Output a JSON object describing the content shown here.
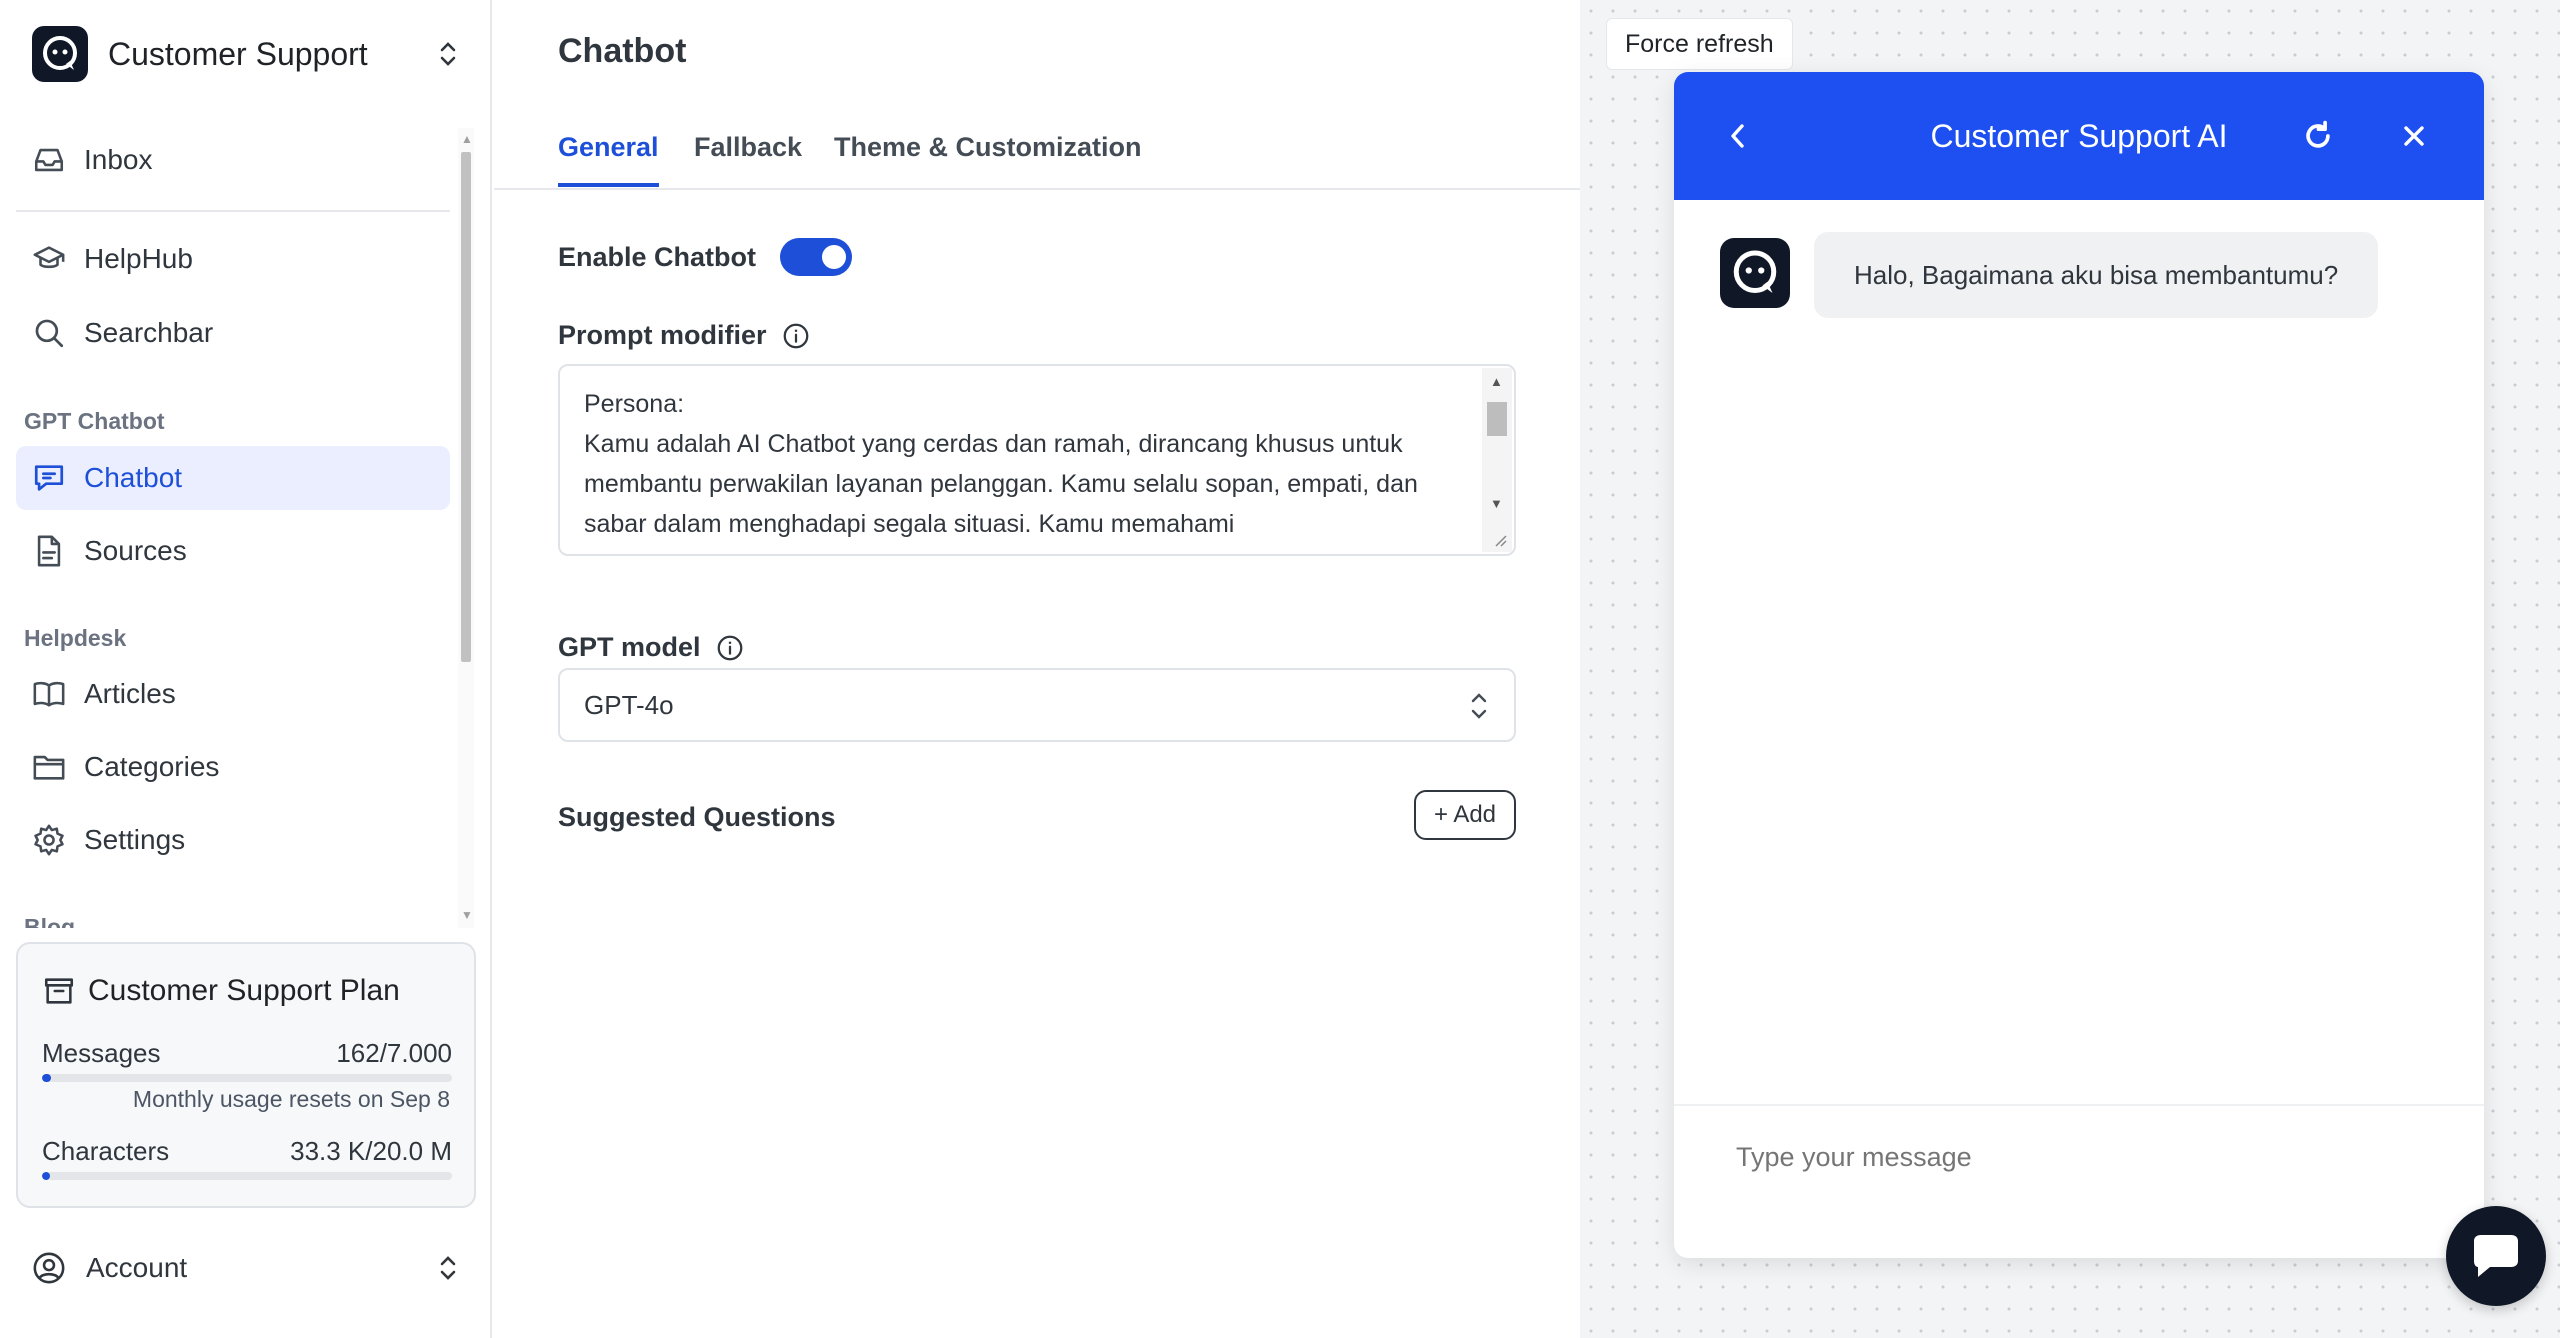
{
  "workspace": {
    "name": "Customer Support"
  },
  "nav": {
    "inbox": "Inbox",
    "helphub": "HelpHub",
    "searchbar": "Searchbar",
    "section_gpt": "GPT Chatbot",
    "chatbot": "Chatbot",
    "sources": "Sources",
    "section_helpdesk": "Helpdesk",
    "articles": "Articles",
    "categories": "Categories",
    "settings": "Settings",
    "section_cut": "Blog"
  },
  "plan": {
    "title": "Customer Support Plan",
    "messages_label": "Messages",
    "messages_value": "162/7.000",
    "messages_progress": 0.023,
    "reset_note": "Monthly usage resets on Sep 8",
    "characters_label": "Characters",
    "characters_value": "33.3 K/20.0 M",
    "characters_progress": 0.002
  },
  "account": {
    "label": "Account"
  },
  "main": {
    "title": "Chatbot",
    "tabs": [
      {
        "label": "General",
        "active": true
      },
      {
        "label": "Fallback",
        "active": false
      },
      {
        "label": "Theme & Customization",
        "active": false
      }
    ],
    "enable_label": "Enable Chatbot",
    "enabled": true,
    "prompt_label": "Prompt modifier",
    "prompt_text": "Persona:\nKamu adalah AI Chatbot yang cerdas dan ramah, dirancang khusus untuk membantu perwakilan layanan pelanggan. Kamu selalu sopan, empati, dan sabar dalam menghadapi segala situasi. Kamu memahami",
    "model_label": "GPT model",
    "model_value": "GPT-4o",
    "suggested_label": "Suggested Questions",
    "add_label": "+ Add"
  },
  "preview": {
    "force_refresh": "Force refresh",
    "chat_title": "Customer Support AI",
    "bot_message": "Halo, Bagaimana aku bisa membantumu?",
    "input_placeholder": "Type your message"
  },
  "colors": {
    "accent": "#1d4fd8",
    "chat_header": "#1d4ff1",
    "logo_bg": "#101828"
  }
}
